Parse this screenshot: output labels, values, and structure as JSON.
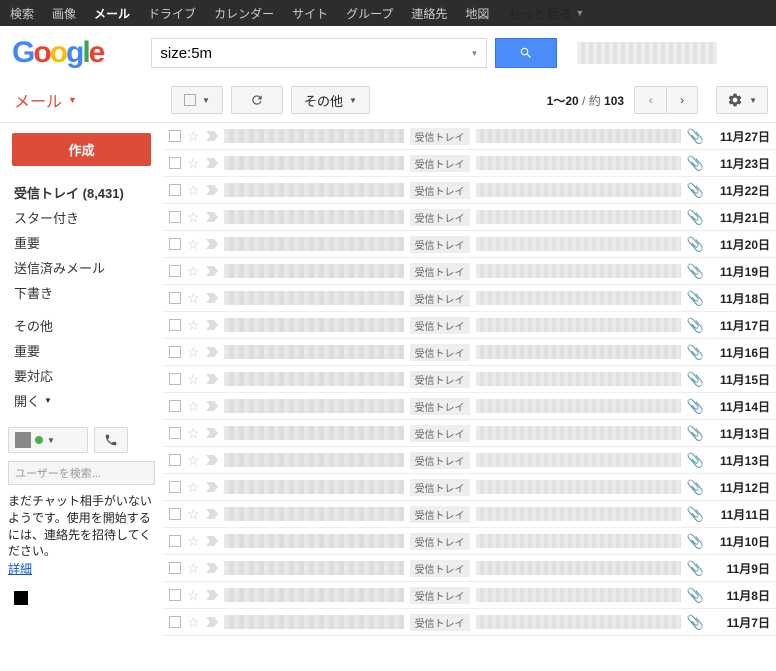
{
  "topnav": {
    "items": [
      "検索",
      "画像",
      "メール",
      "ドライブ",
      "カレンダー",
      "サイト",
      "グループ",
      "連絡先",
      "地図"
    ],
    "more": "もっと見る"
  },
  "search": {
    "value": "size:5m"
  },
  "mail_label": "メール",
  "compose": "作成",
  "sidebar": {
    "inbox": "受信トレイ",
    "inbox_count": "(8,431)",
    "starred": "スター付き",
    "important": "重要",
    "sent": "送信済みメール",
    "drafts": "下書き",
    "other": "その他",
    "important2": "重要",
    "needs_action": "要対応",
    "open": "開く"
  },
  "chat": {
    "search_placeholder": "ユーザーを検索...",
    "msg": "まだチャット相手がいないようです。使用を開始するには、連絡先を招待してください。",
    "detail": "詳細"
  },
  "toolbar": {
    "other": "その他"
  },
  "pager": {
    "range": "1～20",
    "sep": " / 約 ",
    "total": "103"
  },
  "inbox_tag": "受信トレイ",
  "dates": [
    "11月27日",
    "11月23日",
    "11月22日",
    "11月21日",
    "11月20日",
    "11月19日",
    "11月18日",
    "11月17日",
    "11月16日",
    "11月15日",
    "11月14日",
    "11月13日",
    "11月13日",
    "11月12日",
    "11月11日",
    "11月10日",
    "11月9日",
    "11月8日",
    "11月7日"
  ]
}
